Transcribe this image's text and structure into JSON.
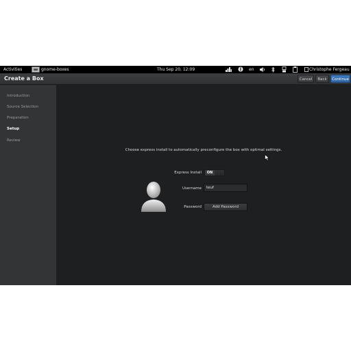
{
  "top_panel": {
    "activities": "Activities",
    "app_name": "gnome-boxes",
    "clock": "Thu Sep 20, 12:09",
    "language": "en",
    "user_name": "Christophe Fergeau"
  },
  "header": {
    "title": "Create a Box",
    "cancel_label": "Cancel",
    "back_label": "Back",
    "continue_label": "Continue"
  },
  "sidebar": {
    "items": [
      {
        "label": "Introduction"
      },
      {
        "label": "Source Selection"
      },
      {
        "label": "Preparation"
      },
      {
        "label": "Setup"
      },
      {
        "label": "Review"
      }
    ],
    "active_index": 3
  },
  "setup": {
    "instructions": "Choose express install to automatically preconfigure the box with optimal settings.",
    "express_install_label": "Express Install",
    "express_install_state": "ON",
    "username_label": "Username",
    "username_value": "teuf",
    "password_label": "Password",
    "add_password_label": "Add Password"
  },
  "colors": {
    "accent": "#3f7bbd",
    "sidebar_bg": "#323436",
    "main_bg": "#1e1f20"
  },
  "icons": [
    "app-icon",
    "wifi-icon",
    "accessibility-icon",
    "volume-icon",
    "bluetooth-icon",
    "network-icon",
    "clipboard-icon",
    "user-icon",
    "avatar-icon",
    "mouse-cursor-icon"
  ]
}
